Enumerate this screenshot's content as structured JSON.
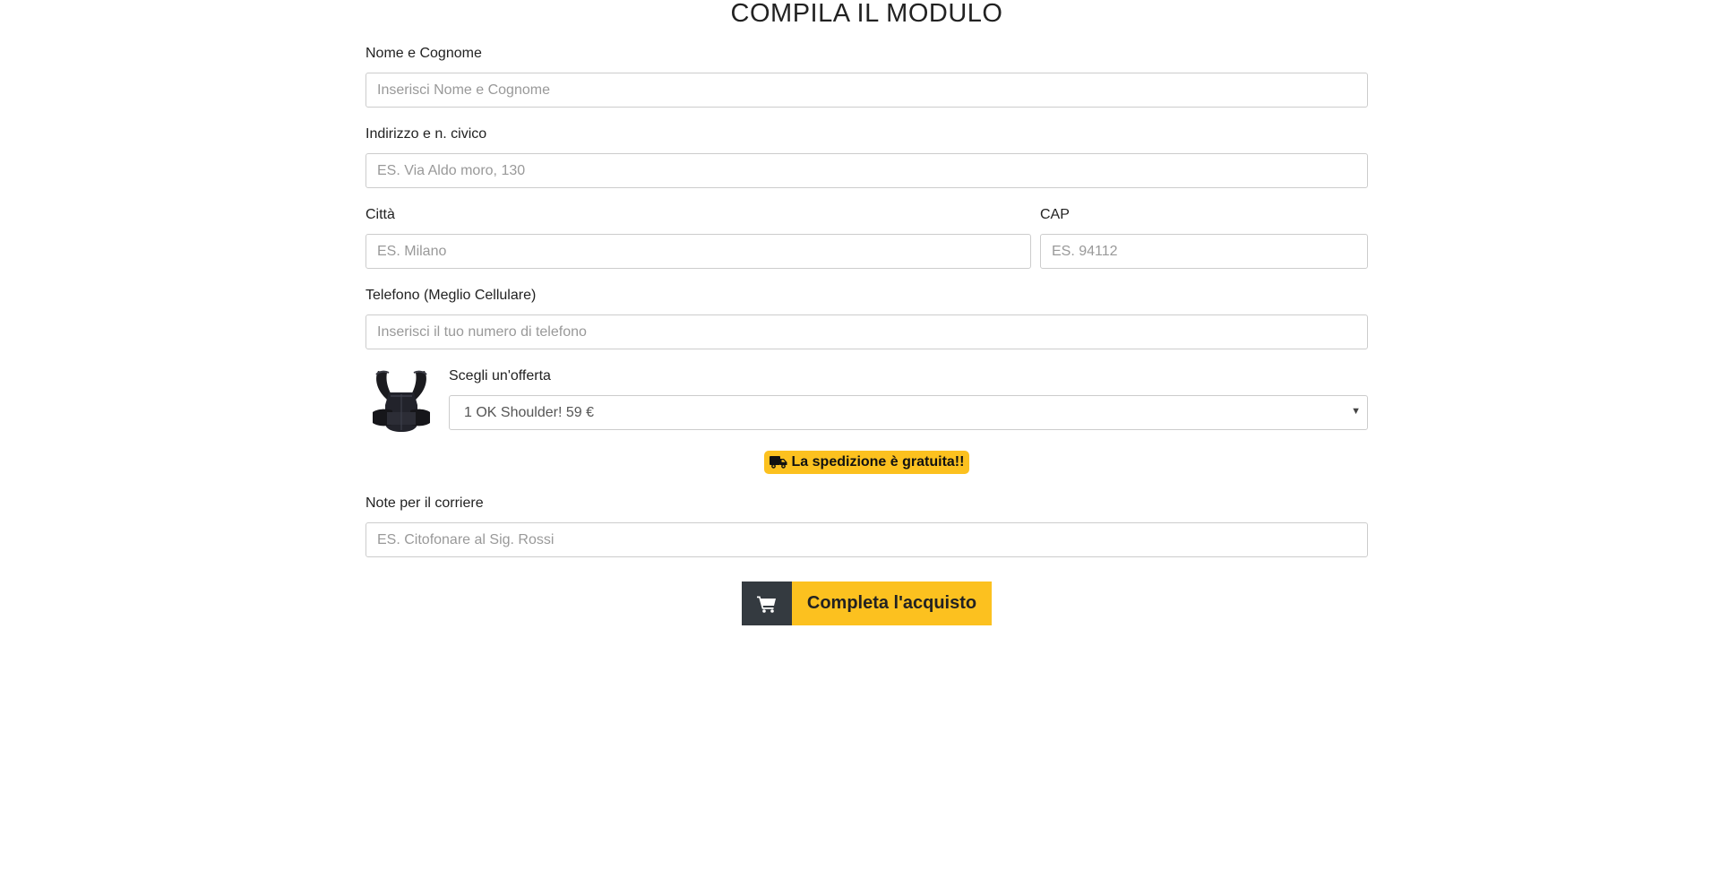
{
  "form": {
    "title": "COMPILA IL MODULO",
    "name": {
      "label": "Nome e Cognome",
      "placeholder": "Inserisci Nome e Cognome",
      "value": ""
    },
    "address": {
      "label": "Indirizzo e n. civico",
      "placeholder": "ES. Via Aldo moro, 130",
      "value": ""
    },
    "city": {
      "label": "Città",
      "placeholder": "ES. Milano",
      "value": ""
    },
    "cap": {
      "label": "CAP",
      "placeholder": "ES. 94112",
      "value": ""
    },
    "phone": {
      "label": "Telefono (Meglio Cellulare)",
      "placeholder": "Inserisci il tuo numero di telefono",
      "value": ""
    },
    "offer": {
      "label": "Scegli un'offerta",
      "selected": "1 OK Shoulder! 59 €",
      "product_icon": "posture-corrector-image"
    },
    "shipping": {
      "text": "La spedizione è gratuita!!",
      "icon": "truck-icon",
      "color": "#fcc11f"
    },
    "notes": {
      "label": "Note per il corriere",
      "placeholder": "ES. Citofonare al Sig. Rossi",
      "value": ""
    },
    "submit": {
      "label": "Completa l'acquisto",
      "icon": "cart-icon",
      "color": "#fcc11f",
      "icon_bg": "#343a40"
    }
  }
}
